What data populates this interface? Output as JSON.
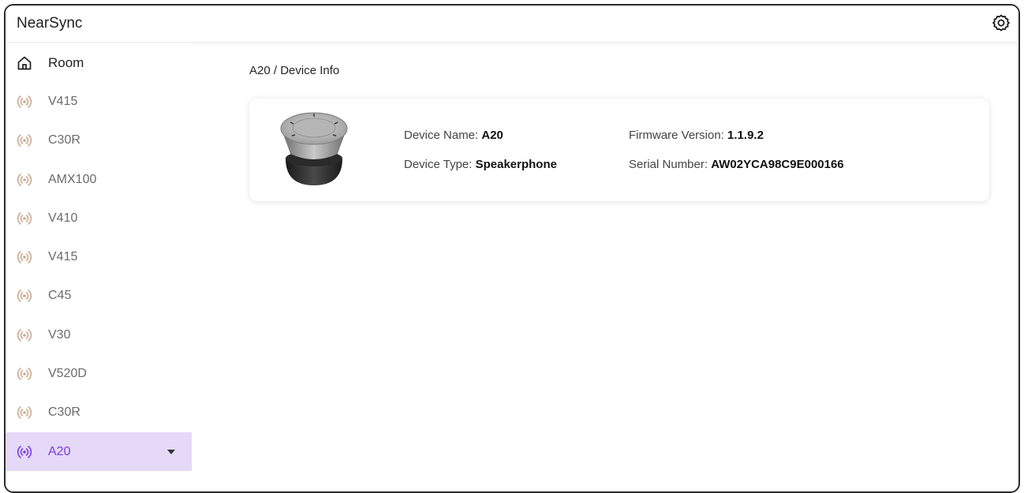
{
  "app": {
    "title": "NearSync"
  },
  "sidebar": {
    "items": [
      {
        "label": "Room",
        "icon": "home-icon"
      },
      {
        "label": "V415",
        "icon": "broadcast-icon"
      },
      {
        "label": "C30R",
        "icon": "broadcast-icon"
      },
      {
        "label": "AMX100",
        "icon": "broadcast-icon"
      },
      {
        "label": "V410",
        "icon": "broadcast-icon"
      },
      {
        "label": "V415",
        "icon": "broadcast-icon"
      },
      {
        "label": "C45",
        "icon": "broadcast-icon"
      },
      {
        "label": "V30",
        "icon": "broadcast-icon"
      },
      {
        "label": "V520D",
        "icon": "broadcast-icon"
      },
      {
        "label": "C30R",
        "icon": "broadcast-icon"
      },
      {
        "label": "A20",
        "icon": "broadcast-icon",
        "selected": true
      }
    ]
  },
  "main": {
    "breadcrumb": "A20 / Device Info",
    "device": {
      "name_label": "Device Name:",
      "name": "A20",
      "type_label": "Device Type:",
      "type": "Speakerphone",
      "firmware_label": "Firmware Version:",
      "firmware": "1.1.9.2",
      "serial_label": "Serial Number:",
      "serial": "AW02YCA98C9E000166"
    }
  },
  "colors": {
    "accent": "#7a3bdc",
    "selected_bg": "#e5d9f7",
    "device_icon": "#c9a990"
  }
}
